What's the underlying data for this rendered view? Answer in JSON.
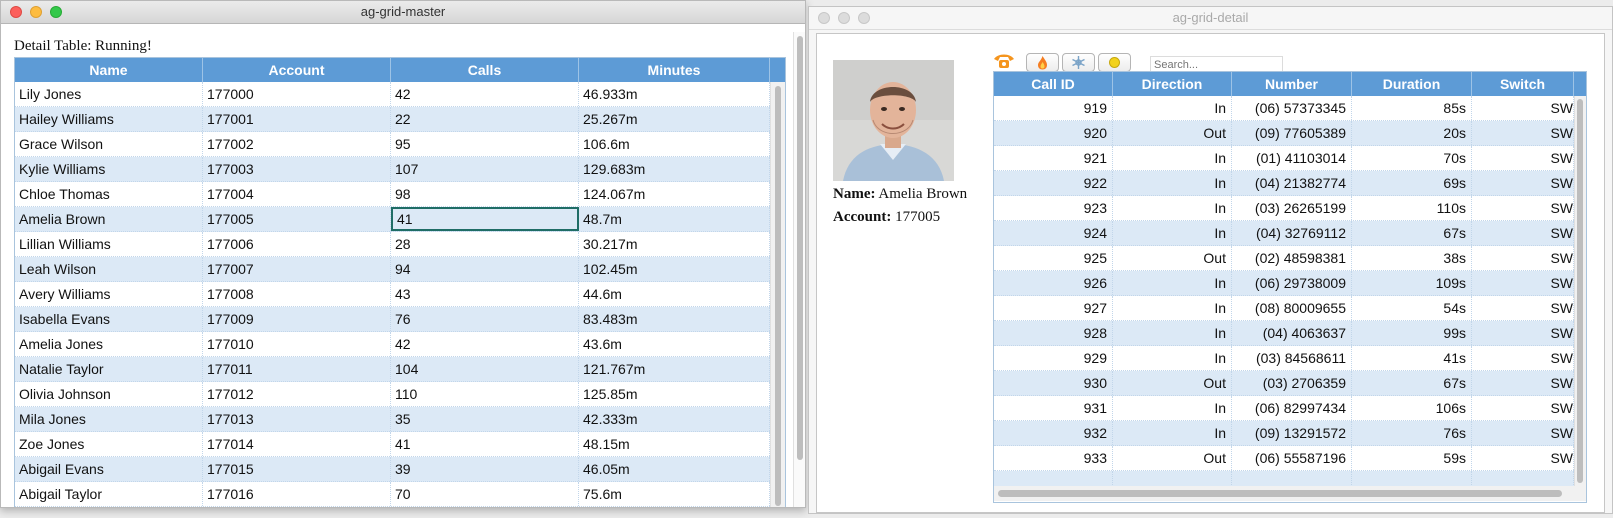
{
  "master": {
    "window_title": "ag-grid-master",
    "status_text": "Detail Table: Running!",
    "columns": [
      "Name",
      "Account",
      "Calls",
      "Minutes"
    ],
    "rows": [
      {
        "name": "Lily Jones",
        "account": "177000",
        "calls": "42",
        "minutes": "46.933m"
      },
      {
        "name": "Hailey Williams",
        "account": "177001",
        "calls": "22",
        "minutes": "25.267m"
      },
      {
        "name": "Grace Wilson",
        "account": "177002",
        "calls": "95",
        "minutes": "106.6m"
      },
      {
        "name": "Kylie Williams",
        "account": "177003",
        "calls": "107",
        "minutes": "129.683m"
      },
      {
        "name": "Chloe Thomas",
        "account": "177004",
        "calls": "98",
        "minutes": "124.067m"
      },
      {
        "name": "Amelia Brown",
        "account": "177005",
        "calls": "41",
        "minutes": "48.7m"
      },
      {
        "name": "Lillian Williams",
        "account": "177006",
        "calls": "28",
        "minutes": "30.217m"
      },
      {
        "name": "Leah Wilson",
        "account": "177007",
        "calls": "94",
        "minutes": "102.45m"
      },
      {
        "name": "Avery Williams",
        "account": "177008",
        "calls": "43",
        "minutes": "44.6m"
      },
      {
        "name": "Isabella Evans",
        "account": "177009",
        "calls": "76",
        "minutes": "83.483m"
      },
      {
        "name": "Amelia Jones",
        "account": "177010",
        "calls": "42",
        "minutes": "43.6m"
      },
      {
        "name": "Natalie Taylor",
        "account": "177011",
        "calls": "104",
        "minutes": "121.767m"
      },
      {
        "name": "Olivia Johnson",
        "account": "177012",
        "calls": "110",
        "minutes": "125.85m"
      },
      {
        "name": "Mila Jones",
        "account": "177013",
        "calls": "35",
        "minutes": "42.333m"
      },
      {
        "name": "Zoe Jones",
        "account": "177014",
        "calls": "41",
        "minutes": "48.15m"
      },
      {
        "name": "Abigail Evans",
        "account": "177015",
        "calls": "39",
        "minutes": "46.05m"
      },
      {
        "name": "Abigail Taylor",
        "account": "177016",
        "calls": "70",
        "minutes": "75.6m"
      }
    ],
    "focused_row": 5,
    "focused_col": 2
  },
  "detail": {
    "window_title": "ag-grid-detail",
    "name_label": "Name:",
    "name_value": "Amelia Brown",
    "account_label": "Account:",
    "account_value": "177005",
    "search_placeholder": "Search...",
    "toolbar_icons": [
      "phone-icon",
      "fire-icon",
      "snowflake-icon",
      "sun-icon"
    ],
    "columns": [
      "Call ID",
      "Direction",
      "Number",
      "Duration",
      "Switch"
    ],
    "rows": [
      {
        "id": "919",
        "direction": "In",
        "number": "(06) 57373345",
        "duration": "85s",
        "switch": "SW"
      },
      {
        "id": "920",
        "direction": "Out",
        "number": "(09) 77605389",
        "duration": "20s",
        "switch": "SW"
      },
      {
        "id": "921",
        "direction": "In",
        "number": "(01) 41103014",
        "duration": "70s",
        "switch": "SW"
      },
      {
        "id": "922",
        "direction": "In",
        "number": "(04) 21382774",
        "duration": "69s",
        "switch": "SW"
      },
      {
        "id": "923",
        "direction": "In",
        "number": "(03) 26265199",
        "duration": "110s",
        "switch": "SW"
      },
      {
        "id": "924",
        "direction": "In",
        "number": "(04) 32769112",
        "duration": "67s",
        "switch": "SW"
      },
      {
        "id": "925",
        "direction": "Out",
        "number": "(02) 48598381",
        "duration": "38s",
        "switch": "SW"
      },
      {
        "id": "926",
        "direction": "In",
        "number": "(06) 29738009",
        "duration": "109s",
        "switch": "SW"
      },
      {
        "id": "927",
        "direction": "In",
        "number": "(08) 80009655",
        "duration": "54s",
        "switch": "SW"
      },
      {
        "id": "928",
        "direction": "In",
        "number": "(04) 4063637",
        "duration": "99s",
        "switch": "SW"
      },
      {
        "id": "929",
        "direction": "In",
        "number": "(03) 84568611",
        "duration": "41s",
        "switch": "SW"
      },
      {
        "id": "930",
        "direction": "Out",
        "number": "(03) 2706359",
        "duration": "67s",
        "switch": "SW"
      },
      {
        "id": "931",
        "direction": "In",
        "number": "(06) 82997434",
        "duration": "106s",
        "switch": "SW"
      },
      {
        "id": "932",
        "direction": "In",
        "number": "(09) 13291572",
        "duration": "76s",
        "switch": "SW"
      },
      {
        "id": "933",
        "direction": "Out",
        "number": "(06) 55587196",
        "duration": "59s",
        "switch": "SW"
      }
    ]
  },
  "colors": {
    "header_bg": "#5d9bd6",
    "odd_row_bg": "#dce9f6",
    "focus_border": "#1f6d66",
    "close": "#fc605c",
    "minimize": "#fdbc40",
    "zoom": "#34c84a",
    "inactive_light": "#dcdcdc"
  }
}
